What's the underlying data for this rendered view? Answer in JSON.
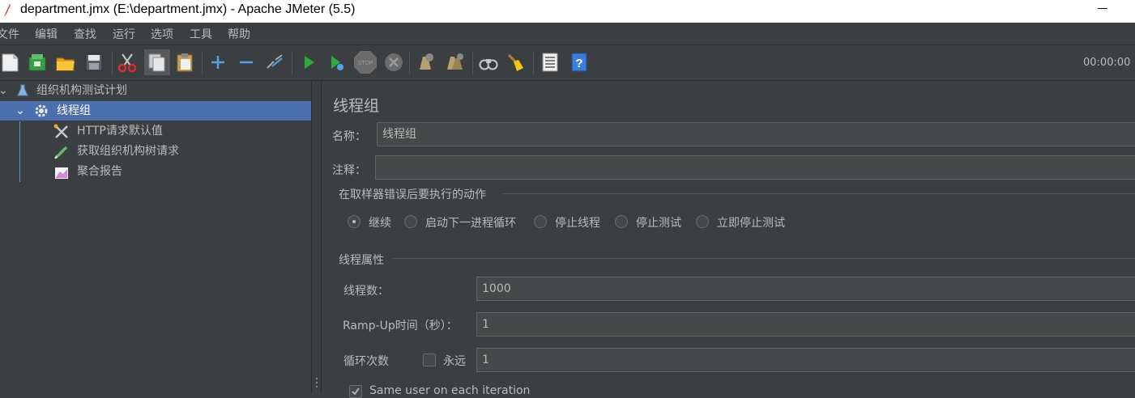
{
  "window": {
    "title": "department.jmx (E:\\department.jmx) - Apache JMeter (5.5)"
  },
  "menu": [
    "文件",
    "编辑",
    "查找",
    "运行",
    "选项",
    "工具",
    "帮助"
  ],
  "toolbar": {
    "icons": [
      "new-icon",
      "templates-icon",
      "open-icon",
      "save-icon",
      "cut-icon",
      "copy-icon",
      "paste-icon",
      "expand-icon",
      "collapse-icon",
      "toggle-icon",
      "start-icon",
      "start-no-pause-icon",
      "stop-icon",
      "shutdown-icon",
      "clear-icon",
      "clear-all-icon",
      "search-icon",
      "reset-search-icon",
      "function-helper-icon",
      "help-icon"
    ],
    "timer": "00:00:00"
  },
  "tree": {
    "items": [
      {
        "label": "组织机构测试计划",
        "icon": "test-plan-icon"
      },
      {
        "label": "线程组",
        "icon": "thread-group-gear-icon"
      },
      {
        "label": "HTTP请求默认值",
        "icon": "config-element-icon"
      },
      {
        "label": "获取组织机构树请求",
        "icon": "sampler-pen-icon"
      },
      {
        "label": "聚合报告",
        "icon": "listener-report-icon"
      }
    ]
  },
  "panel": {
    "title": "线程组",
    "name_label": "名称：",
    "name_value": "线程组",
    "comment_label": "注释：",
    "comment_value": "",
    "error_action_group": "在取样器错误后要执行的动作",
    "error_actions": [
      "继续",
      "启动下一进程循环",
      "停止线程",
      "停止测试",
      "立即停止测试"
    ],
    "selected_action": "继续",
    "thread_props_group": "线程属性",
    "threads_label": "线程数：",
    "threads_value": "1000",
    "rampup_label": "Ramp-Up时间（秒）：",
    "rampup_value": "1",
    "loop_label": "循环次数",
    "forever_label": "永远",
    "forever_checked": false,
    "loop_value": "1",
    "same_user_label": "Same user on each iteration",
    "same_user_checked": true
  },
  "colors": {
    "background": "#3c3f41",
    "selection": "#4b6eaf",
    "text": "#bbbbbb"
  }
}
